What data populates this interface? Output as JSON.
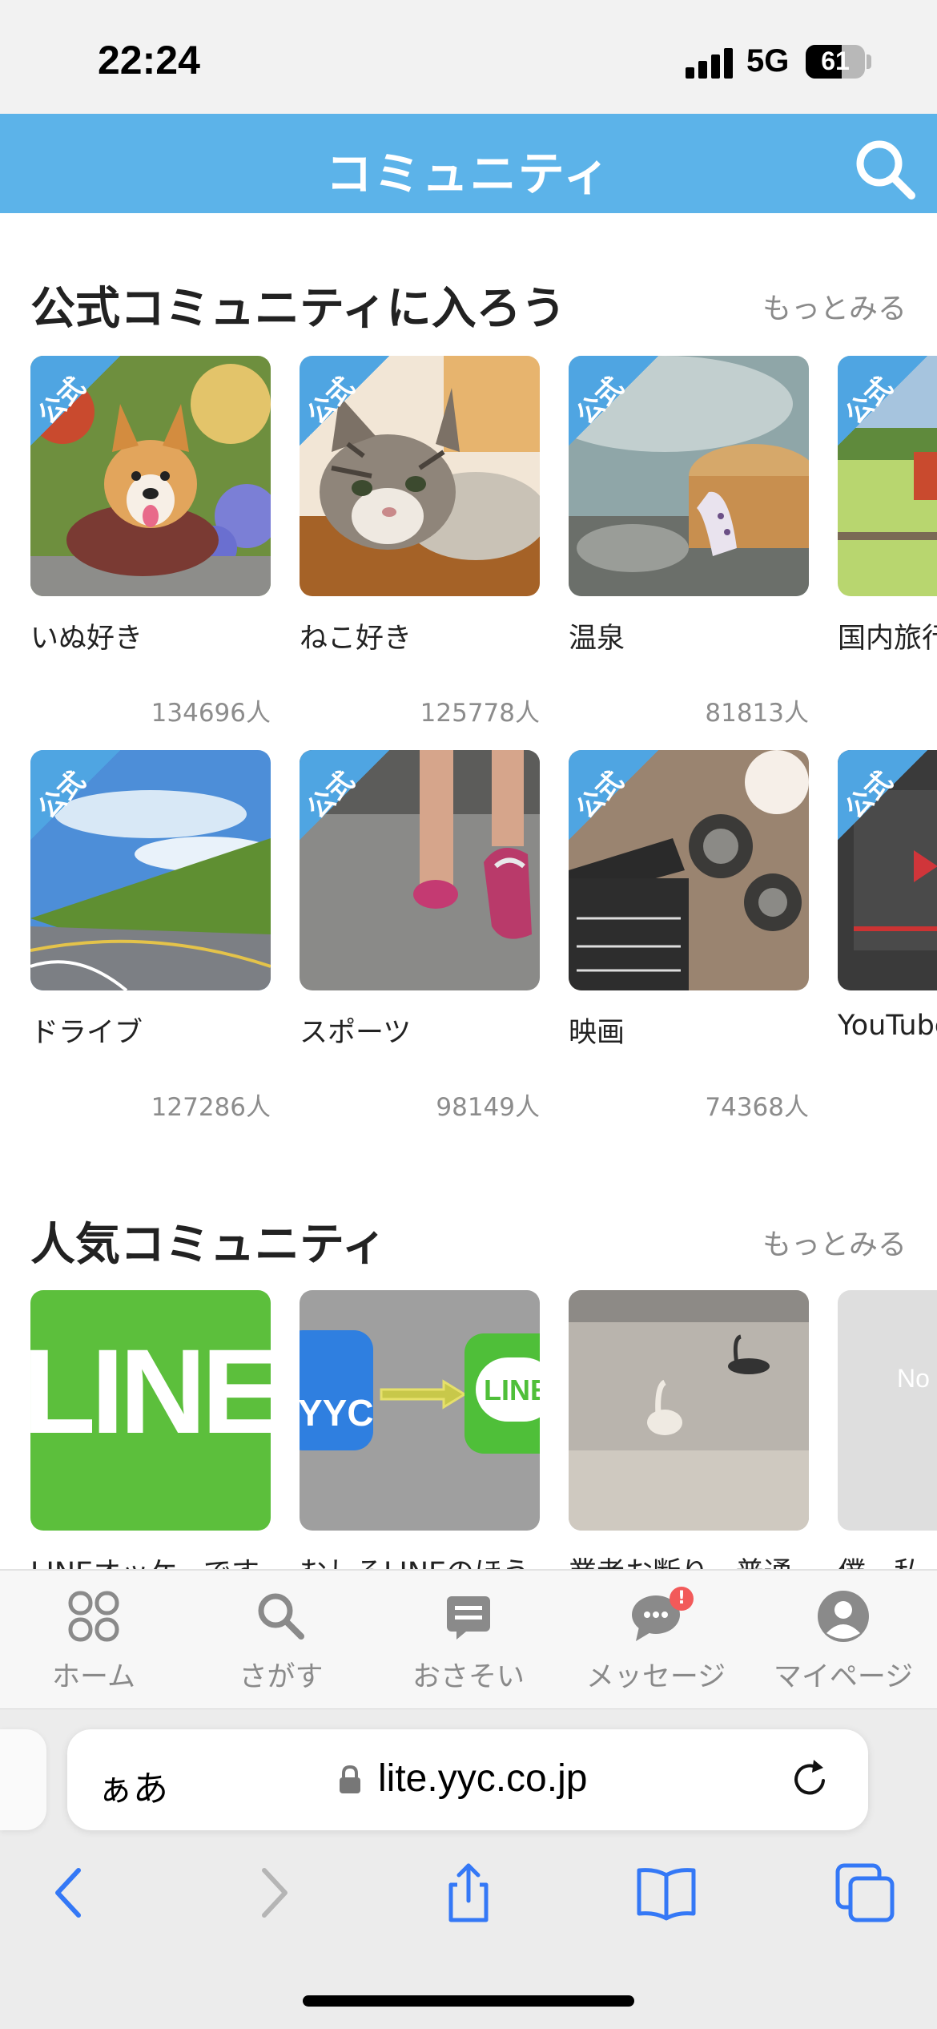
{
  "status_bar": {
    "time": "22:24",
    "network": "5G",
    "battery": "61"
  },
  "header": {
    "title": "コミュニティ",
    "search_icon": "search-icon"
  },
  "official": {
    "title": "公式コミュニティに入ろう",
    "more": "もっとみる",
    "badge": "公式",
    "items": [
      {
        "name": "いぬ好き",
        "count": "134696人"
      },
      {
        "name": "ねこ好き",
        "count": "125778人"
      },
      {
        "name": "温泉",
        "count": "81813人"
      },
      {
        "name": "国内旅行",
        "count": ""
      },
      {
        "name": "ドライブ",
        "count": "127286人"
      },
      {
        "name": "スポーツ",
        "count": "98149人"
      },
      {
        "name": "映画",
        "count": "74368人"
      },
      {
        "name": "YouTube",
        "count": ""
      }
    ]
  },
  "popular": {
    "title": "人気コミュニティ",
    "more": "もっとみる",
    "items": [
      {
        "name": "LINEオッケーです",
        "art": "LINE"
      },
      {
        "name": "むしろLINEのほう",
        "art_left": "YYC",
        "art_right": "LINE"
      },
      {
        "name": "業者お断り、普通",
        "art": ""
      },
      {
        "name": "僕、私",
        "art": "No"
      }
    ]
  },
  "tabbar": {
    "items": [
      {
        "label": "ホーム",
        "icon": "home-clover-icon"
      },
      {
        "label": "さがす",
        "icon": "search-icon"
      },
      {
        "label": "おさそい",
        "icon": "invite-icon"
      },
      {
        "label": "メッセージ",
        "icon": "message-icon",
        "badge": "!"
      },
      {
        "label": "マイページ",
        "icon": "user-icon"
      }
    ]
  },
  "browser": {
    "aa": "ぁあ",
    "url": "lite.yyc.co.jp"
  },
  "colors": {
    "header": "#5cb3e9",
    "badge": "#4fa5e2",
    "ios_blue": "#3478f6"
  }
}
